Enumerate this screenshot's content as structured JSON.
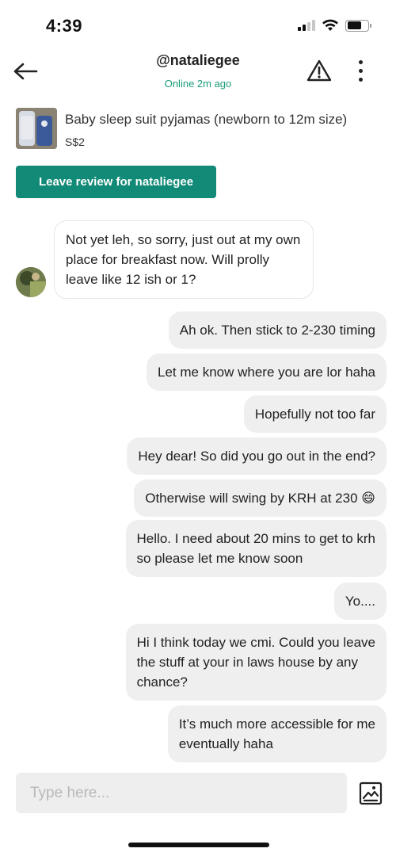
{
  "status_bar": {
    "time": "4:39"
  },
  "header": {
    "title": "@nataliegee",
    "subtitle": "Online 2m ago",
    "icons": {
      "back": "arrow-left-icon",
      "report": "warning-triangle-icon",
      "more": "more-vertical-icon"
    }
  },
  "listing": {
    "title": "Baby sleep suit pyjamas (newborn to 12m size)",
    "price": "S$2"
  },
  "review_button": {
    "label": "Leave review for nataliegee"
  },
  "messages": {
    "incoming": {
      "text": "Not yet leh, so sorry, just out at my own place for breakfast now. Will prolly leave like 12 ish or 1?"
    },
    "outgoing": [
      {
        "text": "Ah ok. Then stick to 2-230 timing"
      },
      {
        "text": "Let me know where you are lor haha"
      },
      {
        "text": "Hopefully not too far"
      },
      {
        "text": "Hey dear! So did you go out in the end?"
      },
      {
        "text": "Otherwise will swing by KRH at 230 😄"
      },
      {
        "lines": [
          "Hello. I need about 20 mins to get to krh",
          "so please let me know soon"
        ]
      },
      {
        "text": "Yo...."
      },
      {
        "lines": [
          "Hi I think today we cmi. Could you leave",
          "the stuff at your in laws house by any",
          "chance?"
        ]
      },
      {
        "lines": [
          "It’s much more accessible for me",
          "eventually haha"
        ]
      }
    ]
  },
  "composer": {
    "placeholder": "Type here...",
    "value": "",
    "icon": "image-upload-icon"
  },
  "colors": {
    "accent": "#118a77",
    "online_text": "#1a9c7c",
    "bubble_out": "#efefef"
  }
}
